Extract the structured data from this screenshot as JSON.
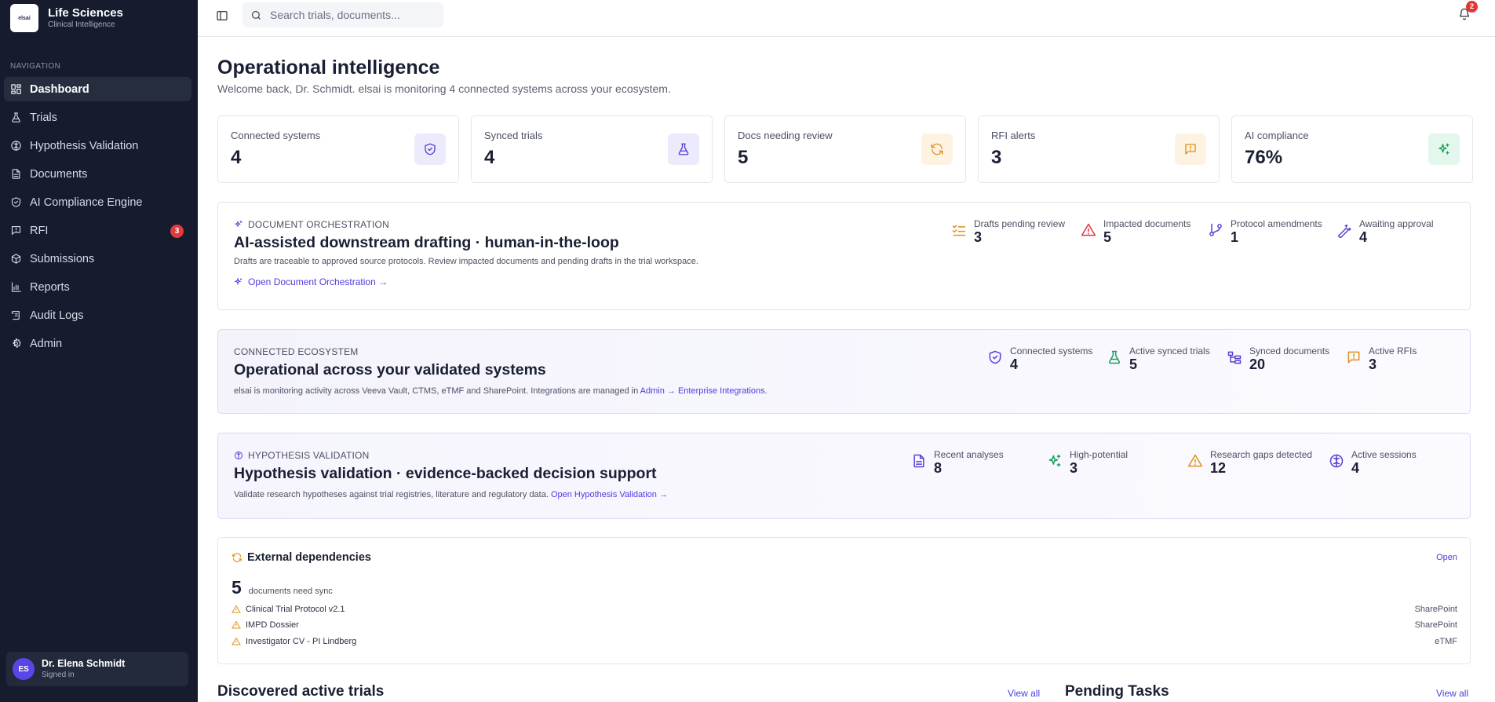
{
  "brand": {
    "logo_text": "elsai",
    "title": "Life Sciences",
    "subtitle": "Clinical Intelligence"
  },
  "sidebar": {
    "section_label": "NAVIGATION",
    "items": [
      {
        "label": "Dashboard",
        "icon": "dashboard-icon",
        "active": true
      },
      {
        "label": "Trials",
        "icon": "flask-icon"
      },
      {
        "label": "Hypothesis Validation",
        "icon": "brain-icon"
      },
      {
        "label": "Documents",
        "icon": "document-icon"
      },
      {
        "label": "AI Compliance Engine",
        "icon": "shield-icon"
      },
      {
        "label": "RFI",
        "icon": "message-icon",
        "badge": "3"
      },
      {
        "label": "Submissions",
        "icon": "package-icon"
      },
      {
        "label": "Reports",
        "icon": "bar-chart-icon"
      },
      {
        "label": "Audit Logs",
        "icon": "scroll-icon"
      },
      {
        "label": "Admin",
        "icon": "gear-icon"
      }
    ]
  },
  "user": {
    "initials": "ES",
    "name": "Dr. Elena Schmidt",
    "status": "Signed in"
  },
  "topbar": {
    "search_placeholder": "Search trials, documents...",
    "notifications_count": "2"
  },
  "header": {
    "title": "Operational intelligence",
    "subtitle": "Welcome back, Dr. Schmidt. elsai is monitoring 4 connected systems across your ecosystem."
  },
  "stats": [
    {
      "label": "Connected systems",
      "value": "4",
      "icon": "shield-check-icon",
      "color": "#5b3fd6",
      "bg": "#ecebfb"
    },
    {
      "label": "Synced trials",
      "value": "4",
      "icon": "flask-icon",
      "color": "#5b3fd6",
      "bg": "#ecebfb"
    },
    {
      "label": "Docs needing review",
      "value": "5",
      "icon": "refresh-icon",
      "color": "#e0911a",
      "bg": "#fdf3e3"
    },
    {
      "label": "RFI alerts",
      "value": "3",
      "icon": "message-alert-icon",
      "color": "#e0911a",
      "bg": "#fdf3e3"
    },
    {
      "label": "AI compliance",
      "value": "76%",
      "icon": "sparkles-icon",
      "color": "#17a05b",
      "bg": "#e4f7ec"
    }
  ],
  "orchestration": {
    "eyebrow": "DOCUMENT ORCHESTRATION",
    "title": "AI-assisted downstream drafting · human-in-the-loop",
    "desc": "Drafts are traceable to approved source protocols. Review impacted documents and pending drafts in the trial workspace.",
    "link": "Open Document Orchestration →",
    "metrics": [
      {
        "label": "Drafts pending review",
        "value": "3",
        "icon": "list-checks-icon"
      },
      {
        "label": "Impacted documents",
        "value": "5",
        "icon": "alert-triangle-icon"
      },
      {
        "label": "Protocol amendments",
        "value": "1",
        "icon": "git-branch-icon"
      },
      {
        "label": "Awaiting approval",
        "value": "4",
        "icon": "magic-wand-icon"
      }
    ]
  },
  "ecosystem": {
    "eyebrow": "CONNECTED ECOSYSTEM",
    "title": "Operational across your validated systems",
    "desc_prefix": "elsai is monitoring activity across Veeva Vault, CTMS, eTMF and SharePoint. Integrations are managed in ",
    "desc_link": "Admin → Enterprise Integrations",
    "desc_suffix": ".",
    "metrics": [
      {
        "label": "Connected systems",
        "value": "4",
        "icon": "shield-check-icon"
      },
      {
        "label": "Active synced trials",
        "value": "5",
        "icon": "flask-icon"
      },
      {
        "label": "Synced documents",
        "value": "20",
        "icon": "folder-tree-icon"
      },
      {
        "label": "Active RFIs",
        "value": "3",
        "icon": "message-alert-icon"
      }
    ]
  },
  "hypothesis": {
    "eyebrow": "HYPOTHESIS VALIDATION",
    "title": "Hypothesis validation · evidence-backed decision support",
    "desc_prefix": "Validate research hypotheses against trial registries, literature and regulatory data. ",
    "desc_link": "Open Hypothesis Validation →",
    "metrics": [
      {
        "label": "Recent analyses",
        "value": "8",
        "icon": "file-text-icon"
      },
      {
        "label": "High-potential",
        "value": "3",
        "icon": "sparkles-icon"
      },
      {
        "label": "Research gaps detected",
        "value": "12",
        "icon": "alert-triangle-icon"
      },
      {
        "label": "Active sessions",
        "value": "4",
        "icon": "brain-icon"
      }
    ]
  },
  "external": {
    "title": "External dependencies",
    "open_label": "Open",
    "count": "5",
    "count_label": "documents need sync",
    "items": [
      {
        "name": "Clinical Trial Protocol v2.1",
        "source": "SharePoint"
      },
      {
        "name": "IMPD Dossier",
        "source": "SharePoint"
      },
      {
        "name": "Investigator CV - PI Lindberg",
        "source": "eTMF"
      }
    ]
  },
  "bottom": {
    "left_title": "Discovered active trials",
    "left_link": "View all",
    "right_title": "Pending Tasks",
    "right_link": "View all"
  }
}
